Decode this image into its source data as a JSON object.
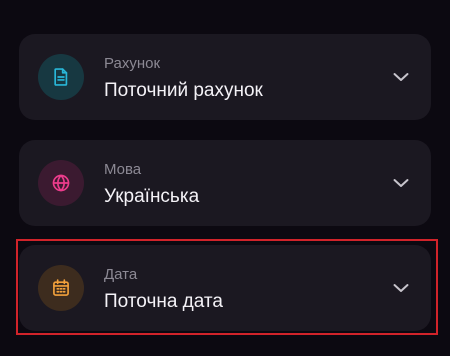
{
  "selectors": [
    {
      "label": "Рахунок",
      "value": "Поточний рахунок",
      "icon": "document-icon",
      "icon_color": "#29b7d8",
      "icon_bg": "#173841"
    },
    {
      "label": "Мова",
      "value": "Українська",
      "icon": "globe-icon",
      "icon_color": "#ec3c8c",
      "icon_bg": "#3b1a30"
    },
    {
      "label": "Дата",
      "value": "Поточна дата",
      "icon": "calendar-icon",
      "icon_color": "#f2a13c",
      "icon_bg": "#3d2c1e"
    }
  ],
  "colors": {
    "background": "#0c0911",
    "card": "#1b1821",
    "label_text": "#8c8994",
    "value_text": "#f4f2f7",
    "chevron": "#c7c4cc",
    "highlight_border": "#d1232a"
  }
}
